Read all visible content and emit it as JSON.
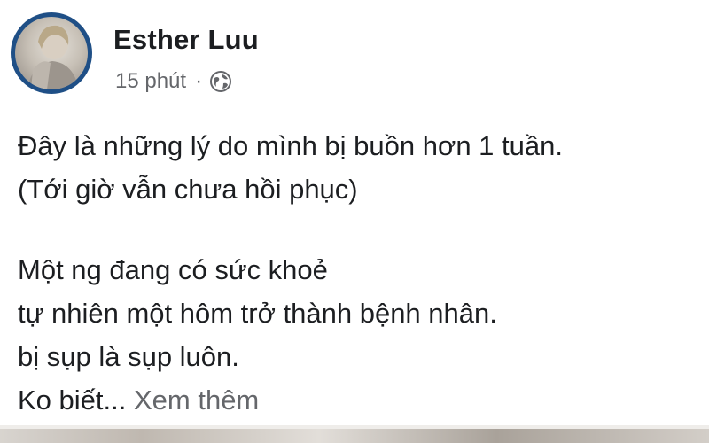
{
  "post": {
    "author_name": "Esther Luu",
    "time_label": "15 phút",
    "separator": "·",
    "privacy_icon": "globe-icon",
    "avatar_icon": "profile-photo",
    "body": {
      "line1": "Đây là những lý do mình bị buồn hơn 1 tuần.",
      "line2": "(Tới giờ vẫn chưa hồi phục)",
      "line3": "Một ng đang có sức khoẻ",
      "line4": "tự nhiên một hôm trở thành bệnh nhân.",
      "line5": "bị sụp là sụp luôn.",
      "line6_text": "Ko biết...",
      "see_more": "Xem thêm"
    }
  },
  "colors": {
    "text_primary": "#1c1e21",
    "text_secondary": "#65676b",
    "avatar_ring": "#1f4f86"
  }
}
